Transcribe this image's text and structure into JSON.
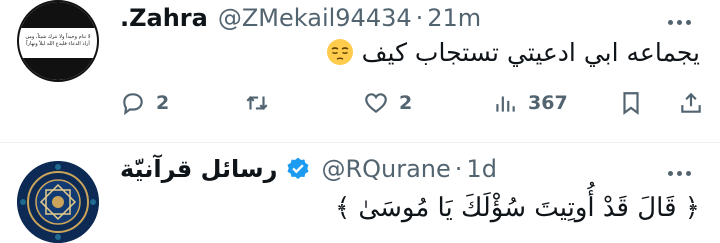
{
  "tweets": [
    {
      "display_name": ".Zahra",
      "handle": "@ZMekail94434",
      "separator": "·",
      "time": "21m",
      "text": "يجماعه ابي ادعيتي تستجاب كيف",
      "avatar_text": "لا تنام وحيداً ولا تترك شيئاً، ومن أراد الدعاء فليدع الله ليلاً ونهاراً",
      "actions": {
        "replies": "2",
        "retweets": "",
        "likes": "2",
        "views": "367"
      }
    },
    {
      "display_name": "رسائل قرآنيّة",
      "handle": "@RQurane",
      "separator": "·",
      "time": "1d",
      "text": "﴿ قَالَ قَدْ أُوتِيتَ سُؤْلَكَ يَا مُوسَىٰ ﴾"
    }
  ],
  "colors": {
    "text_primary": "#0f1419",
    "text_secondary": "#536471",
    "verified_blue": "#1d9bf0",
    "divider": "#eff3f4"
  }
}
